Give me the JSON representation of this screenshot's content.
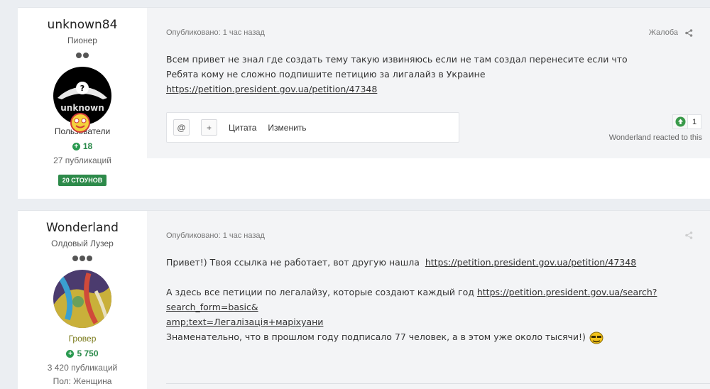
{
  "posts": [
    {
      "author": {
        "username": "unknown84",
        "rank": "Пионер",
        "group": "Пользователи",
        "reputation": "18",
        "posts_count": "27 публикаций",
        "badge": "20 СТОУНОВ",
        "avatar_text": "unknown"
      },
      "meta": "Опубликовано: 1 час назад",
      "report_label": "Жалоба",
      "body": {
        "line1": "Всем привет не знал где создать тему такую извиняюсь если не там создал перенесите если что",
        "line2": "Ребята кому не сложно подпишите петицию за лигалайз в Украине",
        "link": "https://petition.president.gov.ua/petition/47348"
      },
      "toolbar": {
        "mention_icon": "@",
        "multiquote_icon": "+",
        "quote_label": "Цитата",
        "edit_label": "Изменить"
      },
      "reaction": {
        "count": "1",
        "reacted_text": "Wonderland reacted to this"
      }
    },
    {
      "author": {
        "username": "Wonderland",
        "rank": "Олдовый Лузер",
        "group": "Гровер",
        "reputation": "5 750",
        "posts_count": "3 420 публикаций",
        "gender": "Пол: Женщина"
      },
      "meta": "Опубликовано: 1 час назад",
      "body": {
        "line1_prefix": "Привет!) Твоя ссылка не работает, вот другую нашла",
        "line1_link": "https://petition.president.gov.ua/petition/47348",
        "line2_prefix": "А здесь все петиции по легалайзу, которые создают каждый год",
        "line2_link_a": "https://petition.president.gov.ua/search?search_form=basic&",
        "line2_link_b": "amp;text=Легалізація+маріхуани",
        "line3": "Знаменательно, что в прошлом году подписало 77 человек, а в этом уже около тысячи!)"
      }
    }
  ],
  "colors": {
    "reputation_green": "#2a8a4a",
    "badge_green": "#2d8a4a",
    "group_grover": "#7a7a1a"
  }
}
